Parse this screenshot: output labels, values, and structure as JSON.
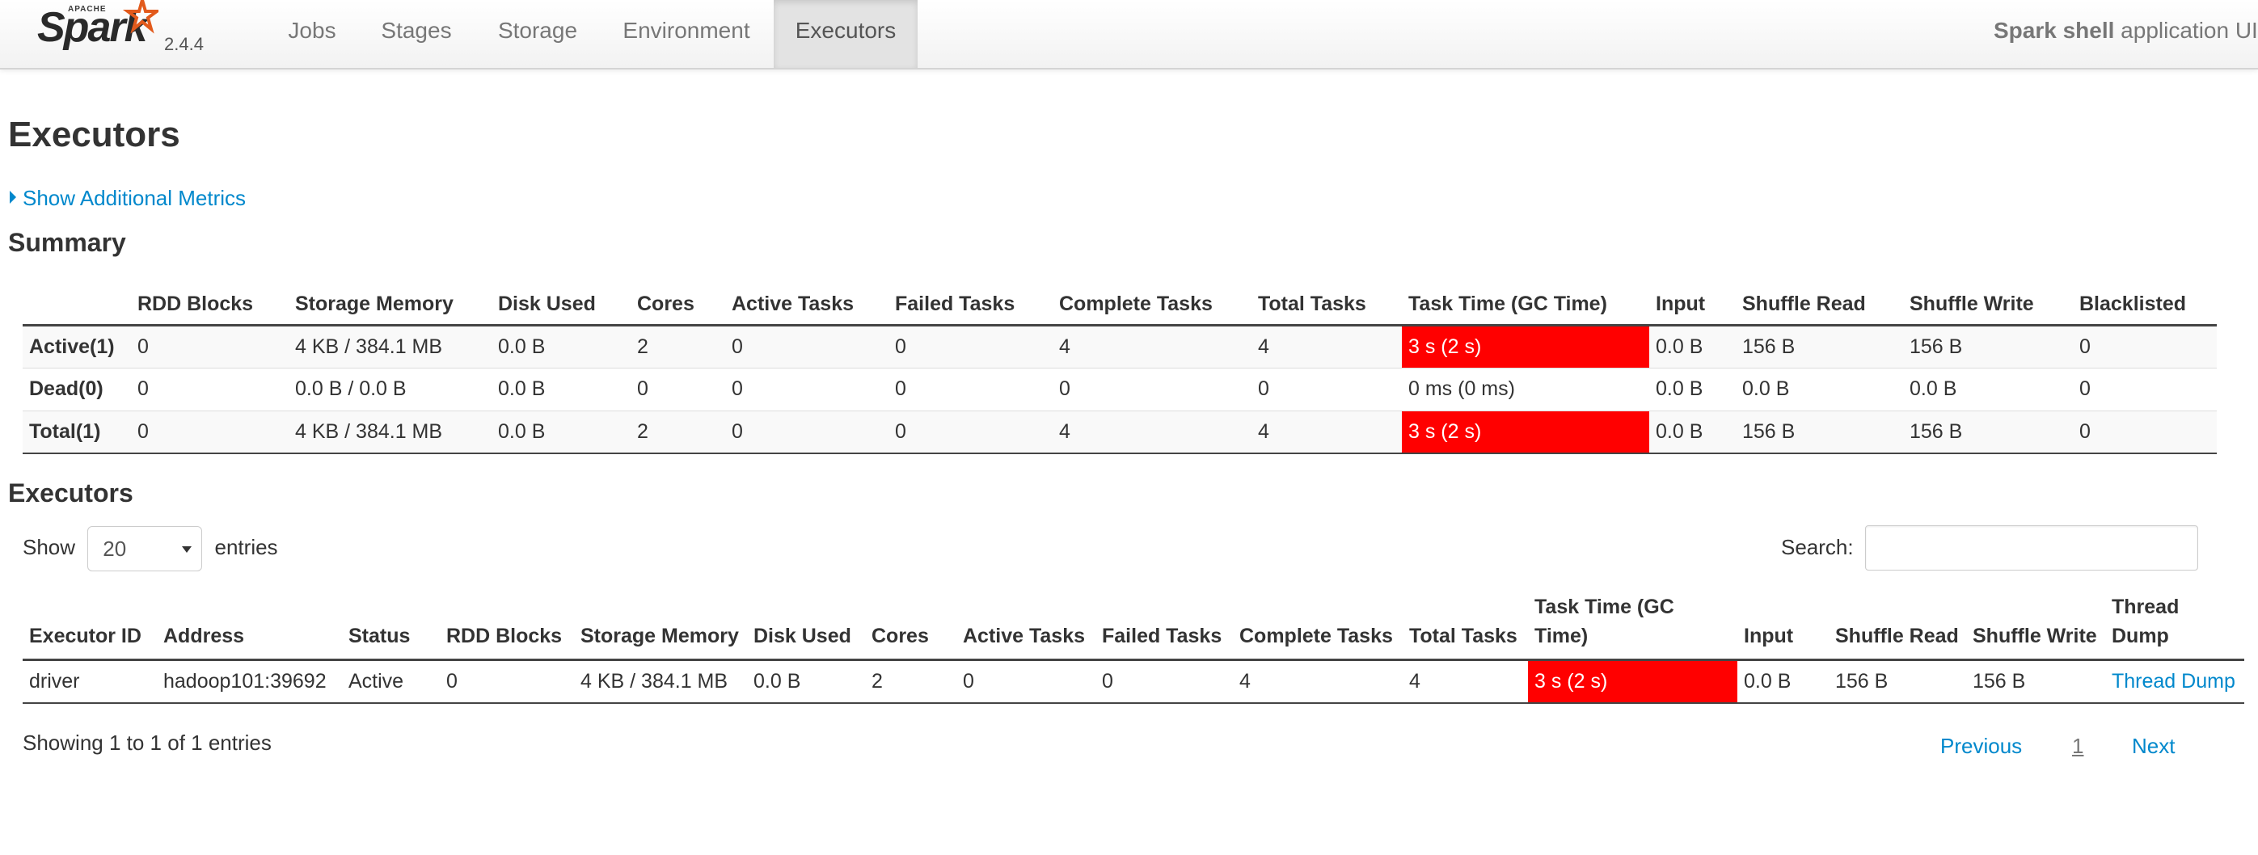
{
  "nav": {
    "logo_apache": "APACHE",
    "logo_text": "Spark",
    "version": "2.4.4",
    "tabs": [
      "Jobs",
      "Stages",
      "Storage",
      "Environment",
      "Executors"
    ],
    "active_tab": "Executors",
    "app_name": "Spark shell",
    "app_suffix": " application UI"
  },
  "page_title": "Executors",
  "additional_metrics": "Show Additional Metrics",
  "summary": {
    "title": "Summary",
    "columns": [
      "",
      "RDD Blocks",
      "Storage Memory",
      "Disk Used",
      "Cores",
      "Active Tasks",
      "Failed Tasks",
      "Complete Tasks",
      "Total Tasks",
      "Task Time (GC Time)",
      "Input",
      "Shuffle Read",
      "Shuffle Write",
      "Blacklisted"
    ],
    "rows": [
      [
        "Active(1)",
        "0",
        "4 KB / 384.1 MB",
        "0.0 B",
        "2",
        "0",
        "0",
        "4",
        "4",
        "3 s (2 s)",
        "0.0 B",
        "156 B",
        "156 B",
        "0"
      ],
      [
        "Dead(0)",
        "0",
        "0.0 B / 0.0 B",
        "0.0 B",
        "0",
        "0",
        "0",
        "0",
        "0",
        "0 ms (0 ms)",
        "0.0 B",
        "0.0 B",
        "0.0 B",
        "0"
      ],
      [
        "Total(1)",
        "0",
        "4 KB / 384.1 MB",
        "0.0 B",
        "2",
        "0",
        "0",
        "4",
        "4",
        "3 s (2 s)",
        "0.0 B",
        "156 B",
        "156 B",
        "0"
      ]
    ]
  },
  "executors": {
    "title": "Executors",
    "show_label": "Show",
    "entries_value": "20",
    "entries_label": "entries",
    "search_label": "Search:",
    "search_value": "",
    "columns": [
      "Executor ID",
      "Address",
      "Status",
      "RDD Blocks",
      "Storage Memory",
      "Disk Used",
      "Cores",
      "Active Tasks",
      "Failed Tasks",
      "Complete Tasks",
      "Total Tasks",
      "Task Time (GC Time)",
      "Input",
      "Shuffle Read",
      "Shuffle Write",
      "Thread Dump"
    ],
    "rows": [
      [
        "driver",
        "hadoop101:39692",
        "Active",
        "0",
        "4 KB / 384.1 MB",
        "0.0 B",
        "2",
        "0",
        "0",
        "4",
        "4",
        "3 s (2 s)",
        "0.0 B",
        "156 B",
        "156 B",
        "Thread Dump"
      ]
    ],
    "info": "Showing 1 to 1 of 1 entries",
    "pager": {
      "previous": "Previous",
      "page": "1",
      "next": "Next"
    }
  },
  "colors": {
    "gc_highlight": "#ff0000",
    "link": "#0088cc"
  }
}
